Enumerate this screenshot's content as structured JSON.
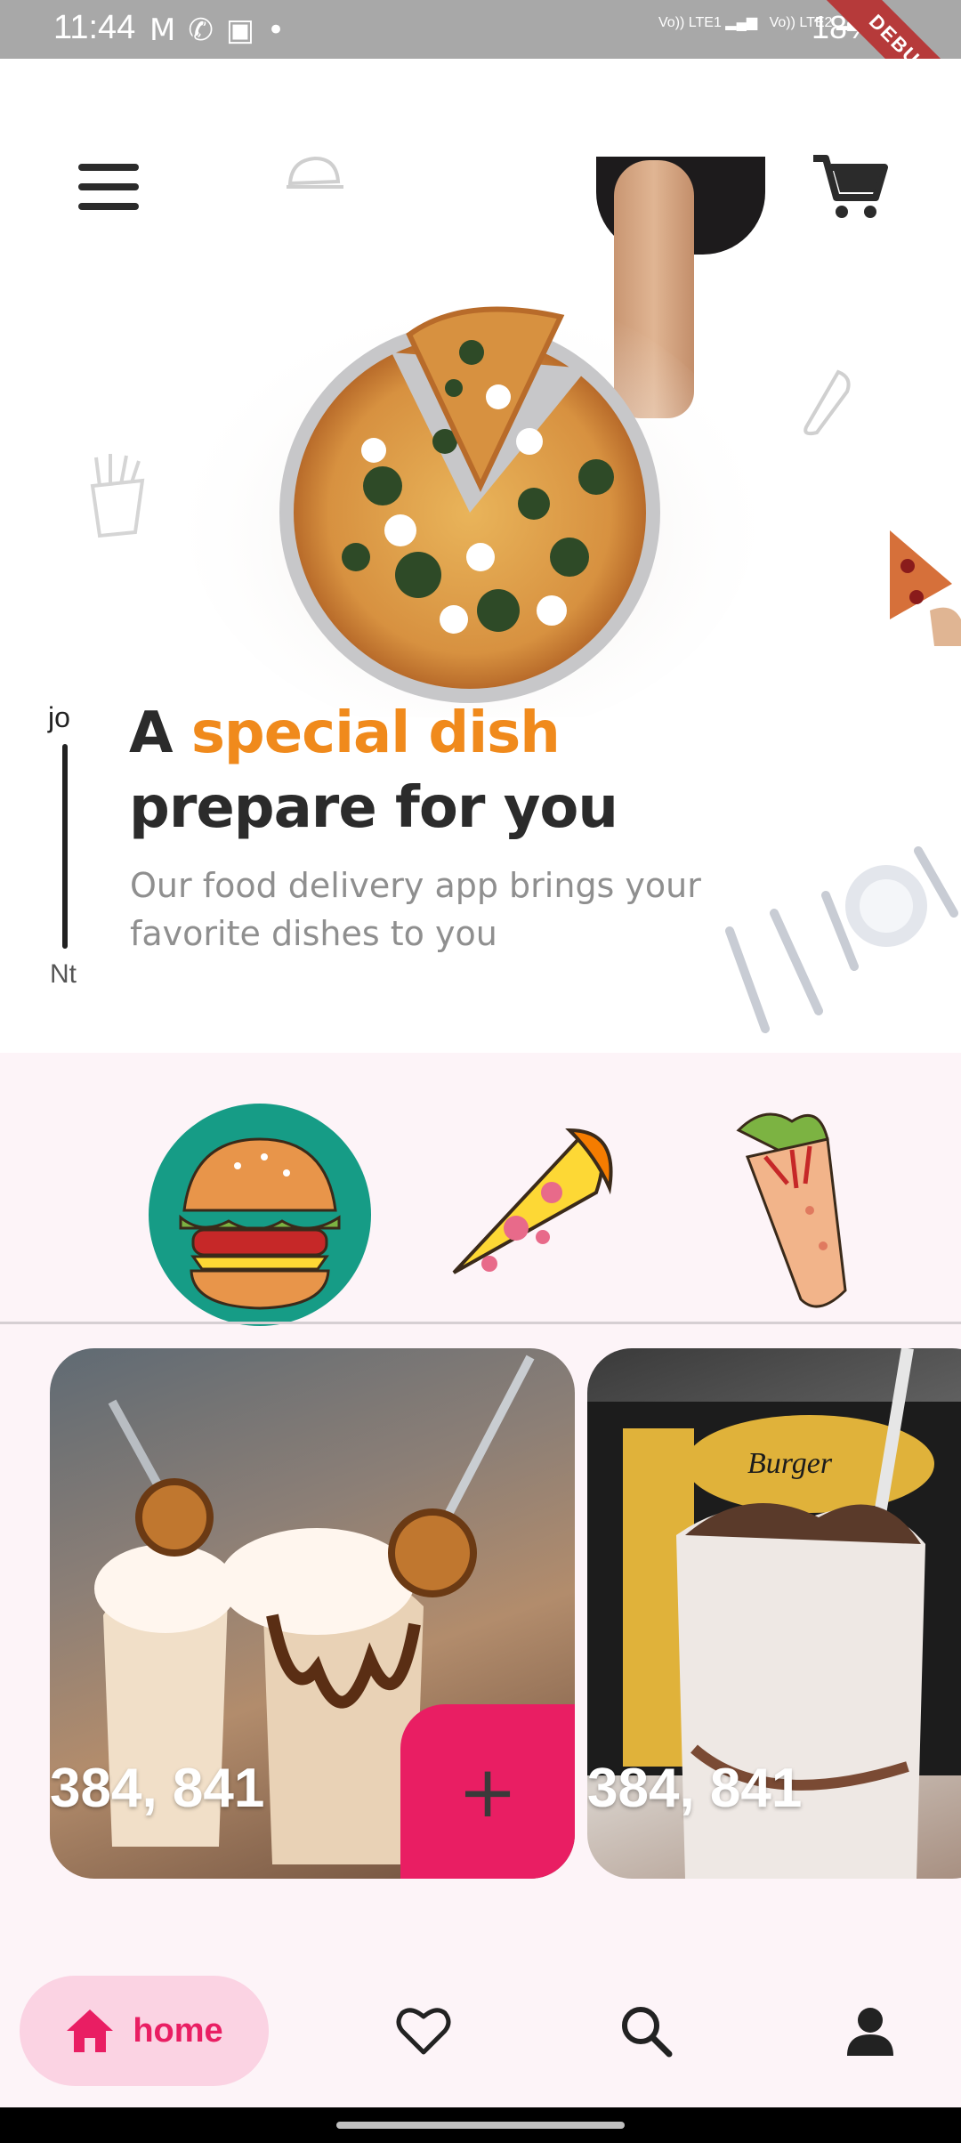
{
  "status_bar": {
    "time": "11:44",
    "notif_icons": [
      "gmail-icon",
      "missed-call-icon",
      "gallery-icon",
      "dot-icon"
    ],
    "network": [
      "Vo)) LTE1",
      "Vo)) LTE2"
    ],
    "battery": "18%",
    "debug_label": "DEBUG"
  },
  "hero": {
    "title_prefix": "A ",
    "title_accent": "special dish",
    "title_line2": "prepare for you",
    "subtitle": "Our food delivery app brings your favorite dishes to you",
    "rail_top": "jo",
    "rail_bottom": "Nt",
    "accent_color": "#f08a1c"
  },
  "categories": [
    {
      "name": "burger",
      "selected": true
    },
    {
      "name": "pizza",
      "selected": false
    },
    {
      "name": "wrap",
      "selected": false
    }
  ],
  "cards": [
    {
      "price": "384, 841",
      "add_label": "+"
    },
    {
      "price": "384, 841",
      "add_label": ""
    }
  ],
  "bottom_nav": {
    "home_label": "home",
    "items": [
      "home-icon",
      "heart-icon",
      "search-icon",
      "person-icon"
    ],
    "accent": "#e91e63"
  }
}
